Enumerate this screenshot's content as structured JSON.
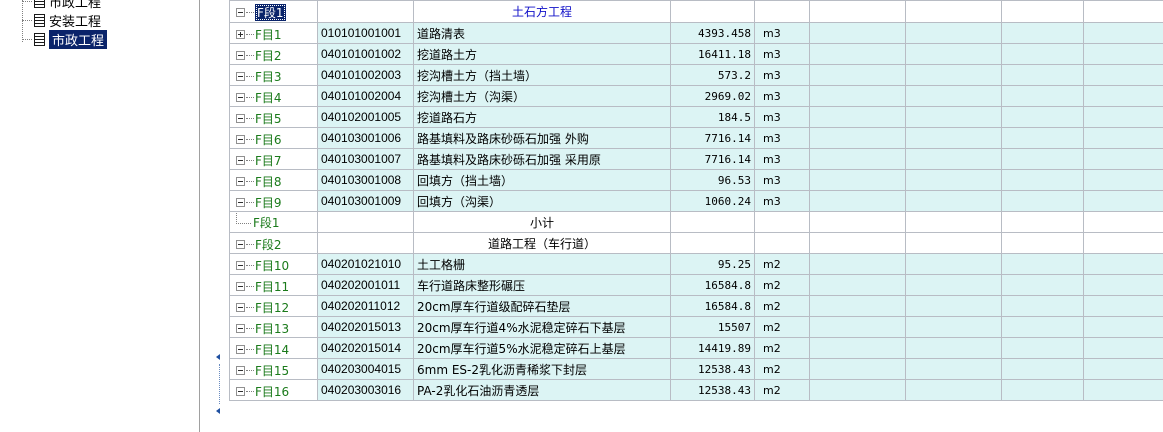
{
  "tree": {
    "items": [
      {
        "label": "市政工程",
        "selected": false
      },
      {
        "label": "安装工程",
        "selected": false
      },
      {
        "label": "市政工程",
        "selected": true
      }
    ]
  },
  "grid": {
    "rows": [
      {
        "kind": "section",
        "tree": "F段1",
        "code": "",
        "name": "土石方工程",
        "qty": "",
        "unit": "",
        "selected": true,
        "toggle": "minus"
      },
      {
        "kind": "item",
        "tree": "F目1",
        "code": "010101001001",
        "name": "道路清表",
        "qty": "4393.458",
        "unit": "m3",
        "toggle": "plus"
      },
      {
        "kind": "item",
        "tree": "F目2",
        "code": "040101001002",
        "name": "挖道路土方",
        "qty": "16411.18",
        "unit": "m3",
        "toggle": "minus"
      },
      {
        "kind": "item",
        "tree": "F目3",
        "code": "040101002003",
        "name": "挖沟槽土方（挡土墙）",
        "qty": "573.2",
        "unit": "m3",
        "toggle": "minus"
      },
      {
        "kind": "item",
        "tree": "F目4",
        "code": "040101002004",
        "name": "挖沟槽土方（沟渠）",
        "qty": "2969.02",
        "unit": "m3",
        "toggle": "minus"
      },
      {
        "kind": "item",
        "tree": "F目5",
        "code": "040102001005",
        "name": "挖道路石方",
        "qty": "184.5",
        "unit": "m3",
        "toggle": "minus"
      },
      {
        "kind": "item",
        "tree": "F目6",
        "code": "040103001006",
        "name": "路基填料及路床砂砾石加强 外购",
        "qty": "7716.14",
        "unit": "m3",
        "toggle": "minus"
      },
      {
        "kind": "item",
        "tree": "F目7",
        "code": "040103001007",
        "name": "路基填料及路床砂砾石加强 采用原",
        "qty": "7716.14",
        "unit": "m3",
        "toggle": "minus"
      },
      {
        "kind": "item",
        "tree": "F目8",
        "code": "040103001008",
        "name": "回填方（挡土墙）",
        "qty": "96.53",
        "unit": "m3",
        "toggle": "minus"
      },
      {
        "kind": "item",
        "tree": "F目9",
        "code": "040103001009",
        "name": "回填方（沟渠）",
        "qty": "1060.24",
        "unit": "m3",
        "toggle": "minus"
      },
      {
        "kind": "subtotal",
        "tree": "F段1",
        "code": "",
        "name": "小计",
        "qty": "",
        "unit": "",
        "toggle": "none"
      },
      {
        "kind": "section",
        "tree": "F段2",
        "code": "",
        "name": "道路工程（车行道）",
        "qty": "",
        "unit": "",
        "toggle": "minus"
      },
      {
        "kind": "item",
        "tree": "F目10",
        "code": "040201021010",
        "name": "土工格栅",
        "qty": "95.25",
        "unit": "m2",
        "toggle": "minus"
      },
      {
        "kind": "item",
        "tree": "F目11",
        "code": "040202001011",
        "name": "车行道路床整形碾压",
        "qty": "16584.8",
        "unit": "m2",
        "toggle": "minus"
      },
      {
        "kind": "item",
        "tree": "F目12",
        "code": "040202011012",
        "name": "20cm厚车行道级配碎石垫层",
        "qty": "16584.8",
        "unit": "m2",
        "toggle": "minus"
      },
      {
        "kind": "item",
        "tree": "F目13",
        "code": "040202015013",
        "name": "20cm厚车行道4%水泥稳定碎石下基层",
        "qty": "15507",
        "unit": "m2",
        "toggle": "minus"
      },
      {
        "kind": "item",
        "tree": "F目14",
        "code": "040202015014",
        "name": "20cm厚车行道5%水泥稳定碎石上基层",
        "qty": "14419.89",
        "unit": "m2",
        "toggle": "minus"
      },
      {
        "kind": "item",
        "tree": "F目15",
        "code": "040203004015",
        "name": "6mm ES-2乳化沥青稀浆下封层",
        "qty": "12538.43",
        "unit": "m2",
        "toggle": "minus"
      },
      {
        "kind": "item",
        "tree": "F目16",
        "code": "040203003016",
        "name": "PA-2乳化石油沥青透层",
        "qty": "12538.43",
        "unit": "m2",
        "toggle": "minus"
      }
    ]
  }
}
